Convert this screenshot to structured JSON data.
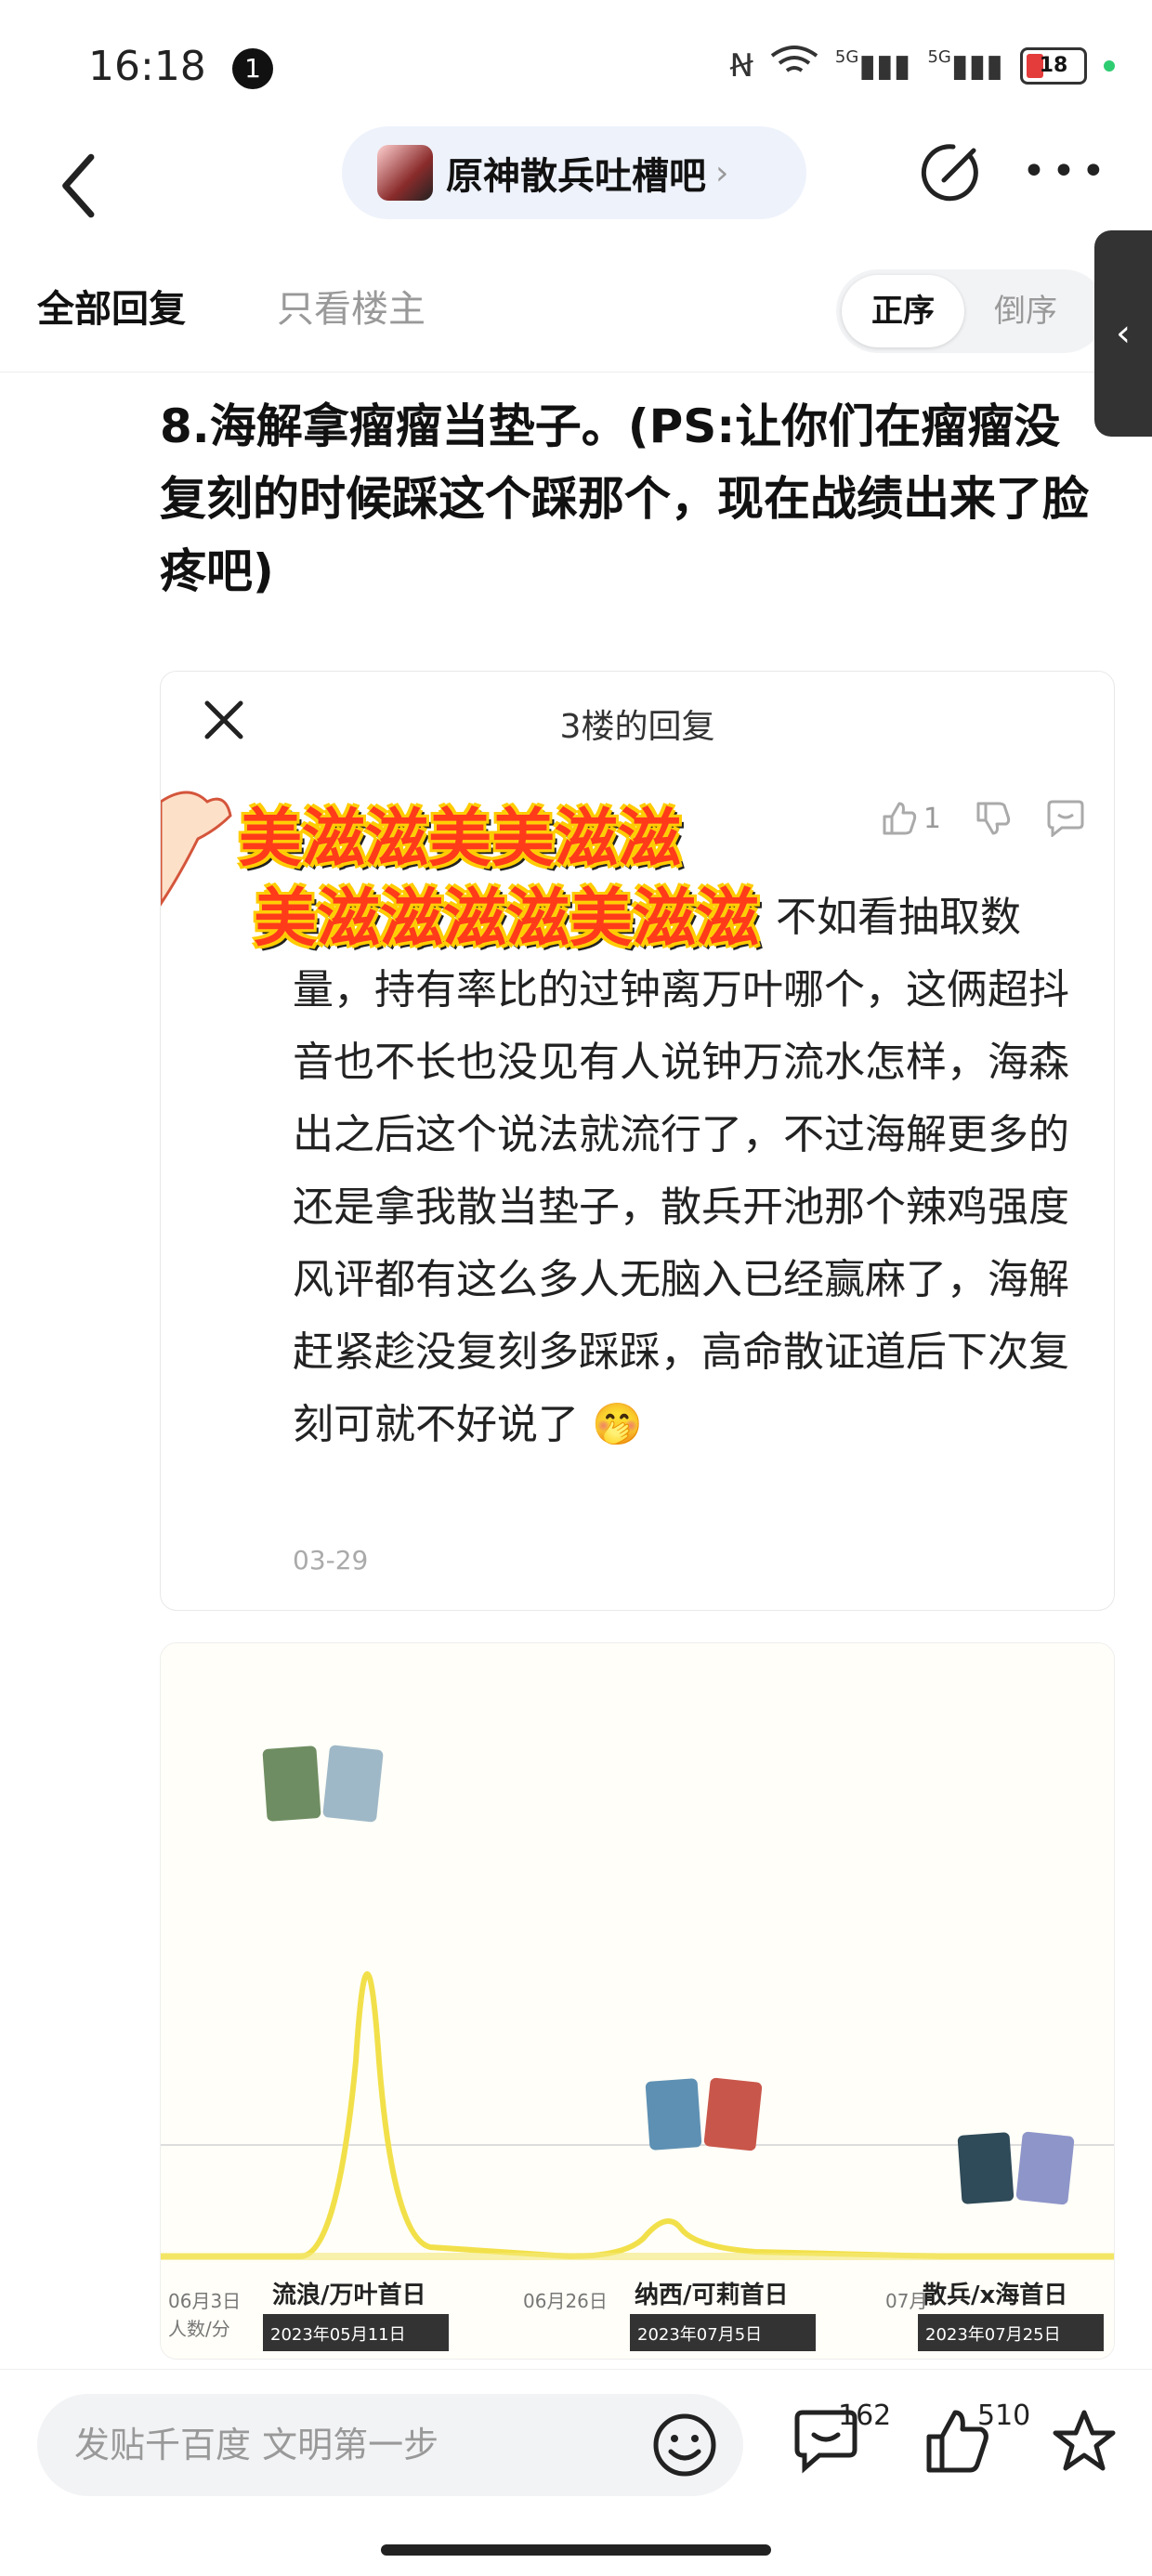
{
  "status_bar": {
    "time": "16:18",
    "notification_count": "1",
    "network_1": "5G",
    "network_2": "5G",
    "battery": "18"
  },
  "nav": {
    "forum_name": "原神散兵吐槽吧"
  },
  "tabs": {
    "all_replies": "全部回复",
    "only_op": "只看楼主",
    "order_asc": "正序",
    "order_desc": "倒序"
  },
  "post": {
    "text": "8.海解拿瘤瘤当垫子。(PS:让你们在瘤瘤没复刻的时候踩这个踩那个，现在战绩出来了脸疼吧)"
  },
  "reply": {
    "title": "3楼的回复",
    "sticker_line1": "美滋滋美美滋滋",
    "sticker_line2": "美滋滋滋滋美滋滋",
    "like_count": "1",
    "first_line": "不如看抽取数",
    "body": "量，持有率比的过钟离万叶哪个，这俩超抖音也不长也没见有人说钟万流水怎样，海森出之后这个说法就流行了，不过海解更多的还是拿我散当垫子，散兵开池那个辣鸡强度风评都有这么多人无脑入已经赢麻了，海解赶紧趁没复刻多踩踩，高命散证道后下次复刻可就不好说了",
    "emoji": "🤭",
    "date": "03-29"
  },
  "chart_image": {
    "label1": "流浪/万叶首日",
    "label2": "纳西/可莉首日",
    "label3": "散兵/x海首日",
    "date1": "2023年05月11日",
    "date2": "2023年07月5日",
    "date3": "2023年07月25日",
    "tick1": "06月3日",
    "tick2": "06月26日",
    "tick3": "07月",
    "legend": "人数/分"
  },
  "bottom": {
    "placeholder": "发贴千百度 文明第一步",
    "comment_count": "162",
    "like_count": "510"
  }
}
